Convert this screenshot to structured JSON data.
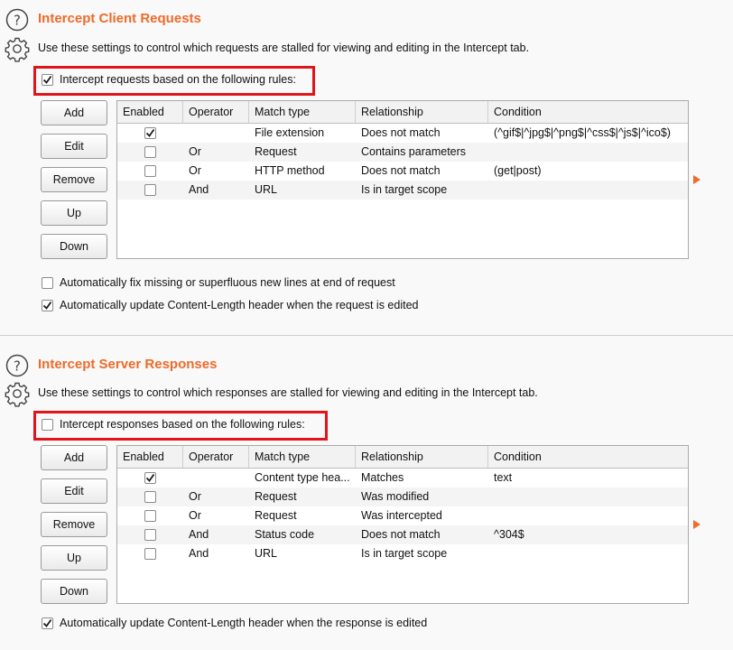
{
  "requests": {
    "title": "Intercept Client Requests",
    "description": "Use these settings to control which requests are stalled for viewing and editing in the Intercept tab.",
    "master_rule": {
      "label": "Intercept requests based on the following rules:",
      "checked": true
    },
    "buttons": [
      "Add",
      "Edit",
      "Remove",
      "Up",
      "Down"
    ],
    "columns": [
      "Enabled",
      "Operator",
      "Match type",
      "Relationship",
      "Condition"
    ],
    "rows": [
      {
        "enabled": true,
        "operator": "",
        "match_type": "File extension",
        "relationship": "Does not match",
        "condition": "(^gif$|^jpg$|^png$|^css$|^js$|^ico$)"
      },
      {
        "enabled": false,
        "operator": "Or",
        "match_type": "Request",
        "relationship": "Contains parameters",
        "condition": ""
      },
      {
        "enabled": false,
        "operator": "Or",
        "match_type": "HTTP method",
        "relationship": "Does not match",
        "condition": "(get|post)"
      },
      {
        "enabled": false,
        "operator": "And",
        "match_type": "URL",
        "relationship": "Is in target scope",
        "condition": ""
      }
    ],
    "options": [
      {
        "label": "Automatically fix missing or superfluous new lines at end of request",
        "checked": false
      },
      {
        "label": "Automatically update Content-Length header when the request is edited",
        "checked": true
      }
    ]
  },
  "responses": {
    "title": "Intercept Server Responses",
    "description": "Use these settings to control which responses are stalled for viewing and editing in the Intercept tab.",
    "master_rule": {
      "label": "Intercept responses based on the following rules:",
      "checked": false
    },
    "buttons": [
      "Add",
      "Edit",
      "Remove",
      "Up",
      "Down"
    ],
    "columns": [
      "Enabled",
      "Operator",
      "Match type",
      "Relationship",
      "Condition"
    ],
    "rows": [
      {
        "enabled": true,
        "operator": "",
        "match_type": "Content type hea...",
        "relationship": "Matches",
        "condition": "text"
      },
      {
        "enabled": false,
        "operator": "Or",
        "match_type": "Request",
        "relationship": "Was modified",
        "condition": ""
      },
      {
        "enabled": false,
        "operator": "Or",
        "match_type": "Request",
        "relationship": "Was intercepted",
        "condition": ""
      },
      {
        "enabled": false,
        "operator": "And",
        "match_type": "Status code",
        "relationship": "Does not match",
        "condition": "^304$"
      },
      {
        "enabled": false,
        "operator": "And",
        "match_type": "URL",
        "relationship": "Is in target scope",
        "condition": ""
      }
    ],
    "options": [
      {
        "label": "Automatically update Content-Length header when the response is edited",
        "checked": true
      }
    ]
  },
  "icons": {
    "help": "help-circle-icon",
    "settings": "gear-icon",
    "panel_toggle": "triangle-right-icon"
  },
  "colors": {
    "accent": "#f06a2a",
    "highlight_box": "#e0151b"
  }
}
